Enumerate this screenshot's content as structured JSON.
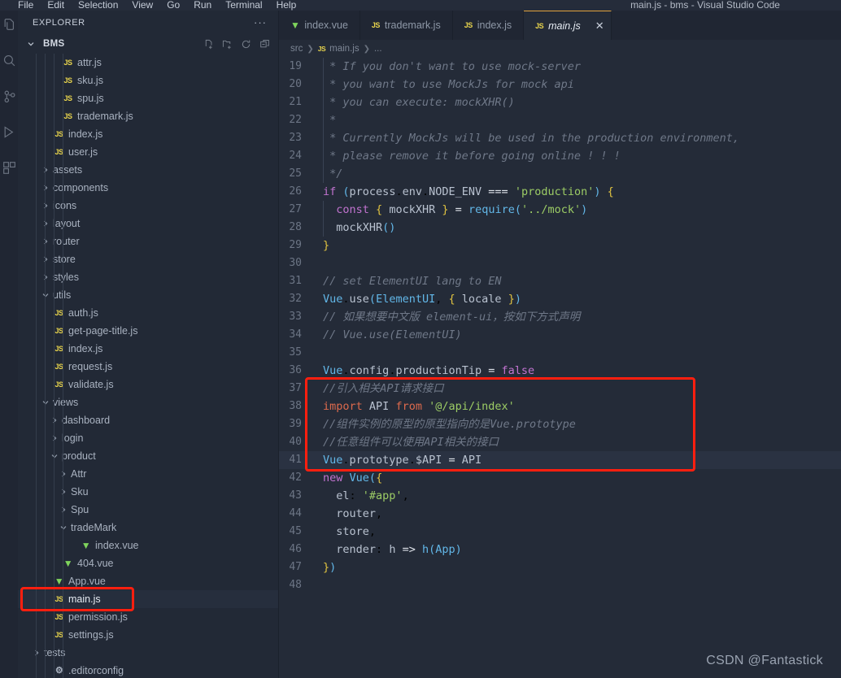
{
  "window": {
    "title": "main.js - bms - Visual Studio Code",
    "menu": [
      "File",
      "Edit",
      "Selection",
      "View",
      "Go",
      "Run",
      "Terminal",
      "Help"
    ]
  },
  "activity_bar": {
    "items": [
      {
        "name": "explorer-icon",
        "label": "Explorer"
      },
      {
        "name": "search-icon",
        "label": "Search"
      },
      {
        "name": "source-control-icon",
        "label": "Source Control"
      },
      {
        "name": "run-debug-icon",
        "label": "Run and Debug"
      },
      {
        "name": "extensions-icon",
        "label": "Extensions"
      }
    ]
  },
  "sidebar": {
    "title": "EXPLORER",
    "more_actions": "···",
    "root": {
      "name": "BMS",
      "actions": [
        "new-file",
        "new-folder",
        "refresh",
        "collapse-all"
      ]
    },
    "tree": [
      {
        "label": "attr.js",
        "indent": 3,
        "kind": "js",
        "twisty": "none"
      },
      {
        "label": "sku.js",
        "indent": 3,
        "kind": "js",
        "twisty": "none"
      },
      {
        "label": "spu.js",
        "indent": 3,
        "kind": "js",
        "twisty": "none"
      },
      {
        "label": "trademark.js",
        "indent": 3,
        "kind": "js",
        "twisty": "none"
      },
      {
        "label": "index.js",
        "indent": 2,
        "kind": "js",
        "twisty": "none"
      },
      {
        "label": "user.js",
        "indent": 2,
        "kind": "js",
        "twisty": "none"
      },
      {
        "label": "assets",
        "indent": 2,
        "kind": "folder",
        "twisty": "collapsed"
      },
      {
        "label": "components",
        "indent": 2,
        "kind": "folder",
        "twisty": "collapsed"
      },
      {
        "label": "icons",
        "indent": 2,
        "kind": "folder",
        "twisty": "collapsed"
      },
      {
        "label": "layout",
        "indent": 2,
        "kind": "folder",
        "twisty": "collapsed"
      },
      {
        "label": "router",
        "indent": 2,
        "kind": "folder",
        "twisty": "collapsed"
      },
      {
        "label": "store",
        "indent": 2,
        "kind": "folder",
        "twisty": "collapsed"
      },
      {
        "label": "styles",
        "indent": 2,
        "kind": "folder",
        "twisty": "collapsed"
      },
      {
        "label": "utils",
        "indent": 2,
        "kind": "folder",
        "twisty": "expanded"
      },
      {
        "label": "auth.js",
        "indent": 2,
        "kind": "js",
        "twisty": "none"
      },
      {
        "label": "get-page-title.js",
        "indent": 2,
        "kind": "js",
        "twisty": "none"
      },
      {
        "label": "index.js",
        "indent": 2,
        "kind": "js",
        "twisty": "none"
      },
      {
        "label": "request.js",
        "indent": 2,
        "kind": "js",
        "twisty": "none"
      },
      {
        "label": "validate.js",
        "indent": 2,
        "kind": "js",
        "twisty": "none"
      },
      {
        "label": "views",
        "indent": 2,
        "kind": "folder",
        "twisty": "expanded"
      },
      {
        "label": "dashboard",
        "indent": 3,
        "kind": "folder",
        "twisty": "collapsed"
      },
      {
        "label": "login",
        "indent": 3,
        "kind": "folder",
        "twisty": "collapsed"
      },
      {
        "label": "product",
        "indent": 3,
        "kind": "folder",
        "twisty": "expanded"
      },
      {
        "label": "Attr",
        "indent": 4,
        "kind": "folder",
        "twisty": "collapsed"
      },
      {
        "label": "Sku",
        "indent": 4,
        "kind": "folder",
        "twisty": "collapsed"
      },
      {
        "label": "Spu",
        "indent": 4,
        "kind": "folder",
        "twisty": "collapsed"
      },
      {
        "label": "tradeMark",
        "indent": 4,
        "kind": "folder",
        "twisty": "expanded"
      },
      {
        "label": "index.vue",
        "indent": 5,
        "kind": "vue",
        "twisty": "none"
      },
      {
        "label": "404.vue",
        "indent": 3,
        "kind": "vue",
        "twisty": "none"
      },
      {
        "label": "App.vue",
        "indent": 2,
        "kind": "vue",
        "twisty": "none"
      },
      {
        "label": "main.js",
        "indent": 2,
        "kind": "js",
        "twisty": "none",
        "selected": true
      },
      {
        "label": "permission.js",
        "indent": 2,
        "kind": "js",
        "twisty": "none"
      },
      {
        "label": "settings.js",
        "indent": 2,
        "kind": "js",
        "twisty": "none"
      },
      {
        "label": "tests",
        "indent": 1,
        "kind": "folder",
        "twisty": "collapsed"
      },
      {
        "label": ".editorconfig",
        "indent": 2,
        "kind": "gear",
        "twisty": "none"
      }
    ]
  },
  "editor": {
    "tabs": [
      {
        "label": "index.vue",
        "kind": "vue",
        "active": false,
        "closable": false
      },
      {
        "label": "trademark.js",
        "kind": "js",
        "active": false,
        "closable": false
      },
      {
        "label": "index.js",
        "kind": "js",
        "active": false,
        "closable": false
      },
      {
        "label": "main.js",
        "kind": "js",
        "active": true,
        "closable": true,
        "close_glyph": "✕"
      }
    ],
    "breadcrumb": [
      "src",
      "main.js",
      "..."
    ],
    "breadcrumb_icon": "JS",
    "first_line": 19,
    "lines": [
      {
        "n": 19,
        "text": " * If you don't want to use mock-server"
      },
      {
        "n": 20,
        "text": " * you want to use MockJs for mock api"
      },
      {
        "n": 21,
        "text": " * you can execute: mockXHR()"
      },
      {
        "n": 22,
        "text": " *"
      },
      {
        "n": 23,
        "text": " * Currently MockJs will be used in the production environment,"
      },
      {
        "n": 24,
        "text": " * please remove it before going online ! ! !"
      },
      {
        "n": 25,
        "text": " */"
      },
      {
        "n": 26,
        "text": "if (process.env.NODE_ENV === 'production') {"
      },
      {
        "n": 27,
        "text": "  const { mockXHR } = require('../mock')"
      },
      {
        "n": 28,
        "text": "  mockXHR()"
      },
      {
        "n": 29,
        "text": "}"
      },
      {
        "n": 30,
        "text": ""
      },
      {
        "n": 31,
        "text": "// set ElementUI lang to EN"
      },
      {
        "n": 32,
        "text": "Vue.use(ElementUI, { locale })"
      },
      {
        "n": 33,
        "text": "// 如果想要中文版 element-ui，按如下方式声明"
      },
      {
        "n": 34,
        "text": "// Vue.use(ElementUI)"
      },
      {
        "n": 35,
        "text": ""
      },
      {
        "n": 36,
        "text": "Vue.config.productionTip = false"
      },
      {
        "n": 37,
        "text": "//引入相关API请求接口"
      },
      {
        "n": 38,
        "text": "import API from '@/api/index'"
      },
      {
        "n": 39,
        "text": "//组件实例的原型的原型指向的是Vue.prototype"
      },
      {
        "n": 40,
        "text": "//任意组件可以使用API相关的接口"
      },
      {
        "n": 41,
        "text": "Vue.prototype.$API = API",
        "current": true
      },
      {
        "n": 42,
        "text": "new Vue({"
      },
      {
        "n": 43,
        "text": "  el: '#app',"
      },
      {
        "n": 44,
        "text": "  router,"
      },
      {
        "n": 45,
        "text": "  store,"
      },
      {
        "n": 46,
        "text": "  render: h => h(App)"
      },
      {
        "n": 47,
        "text": "})"
      },
      {
        "n": 48,
        "text": ""
      }
    ]
  },
  "annotations": {
    "code_highlight_lines": [
      37,
      38,
      39,
      40,
      41
    ],
    "sidebar_highlight": "main.js",
    "box_color": "#ff1f0f"
  },
  "watermark": "CSDN @Fantastick"
}
